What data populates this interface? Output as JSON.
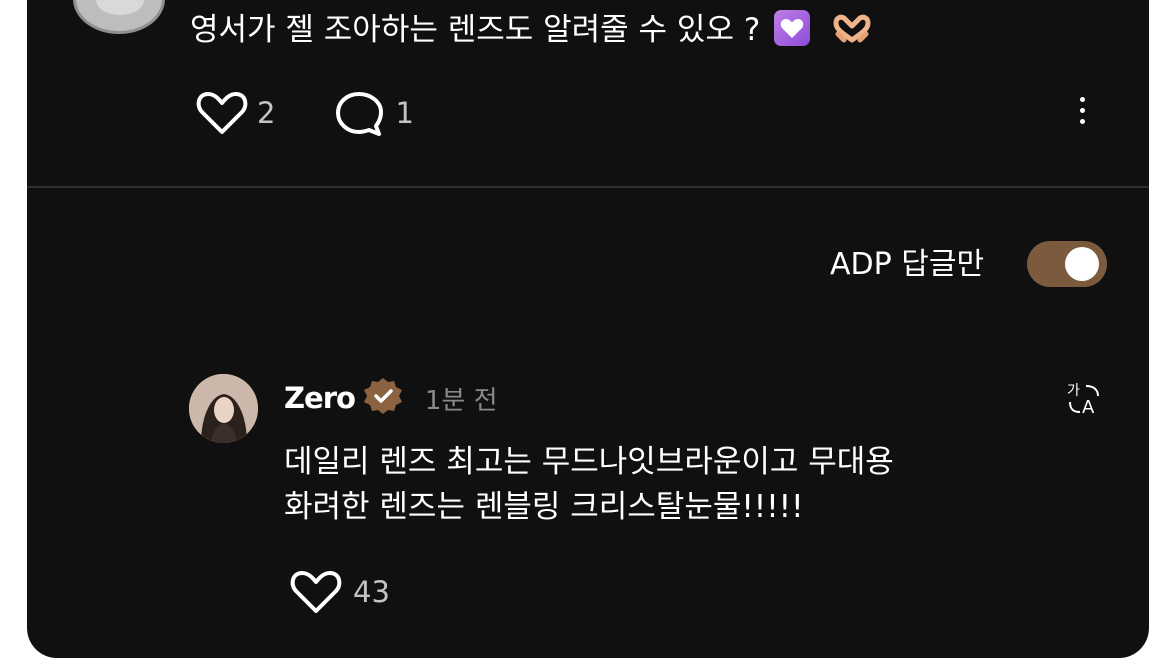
{
  "post": {
    "text": "영서가 젤 조아하는 렌즈도 알려줄 수 있오 ?",
    "emojis": [
      "purple-heart-emoji",
      "heart-hands-emoji"
    ],
    "like_count": "2",
    "reply_count": "1"
  },
  "filter": {
    "label": "ADP 답글만",
    "toggle_on": true,
    "toggle_color": "#7c5a3d"
  },
  "reply": {
    "username": "Zero",
    "verified": true,
    "time": "1분 전",
    "line1": "데일리 렌즈 최고는 무드나잇브라운이고 무대용",
    "line2": "화려한 렌즈는 렌블링 크리스탈눈물!!!!!",
    "like_count": "43"
  },
  "colors": {
    "background": "#101010",
    "divider": "#2e2e2e",
    "muted_text": "#8a8a8a",
    "badge": "#8b6340"
  }
}
